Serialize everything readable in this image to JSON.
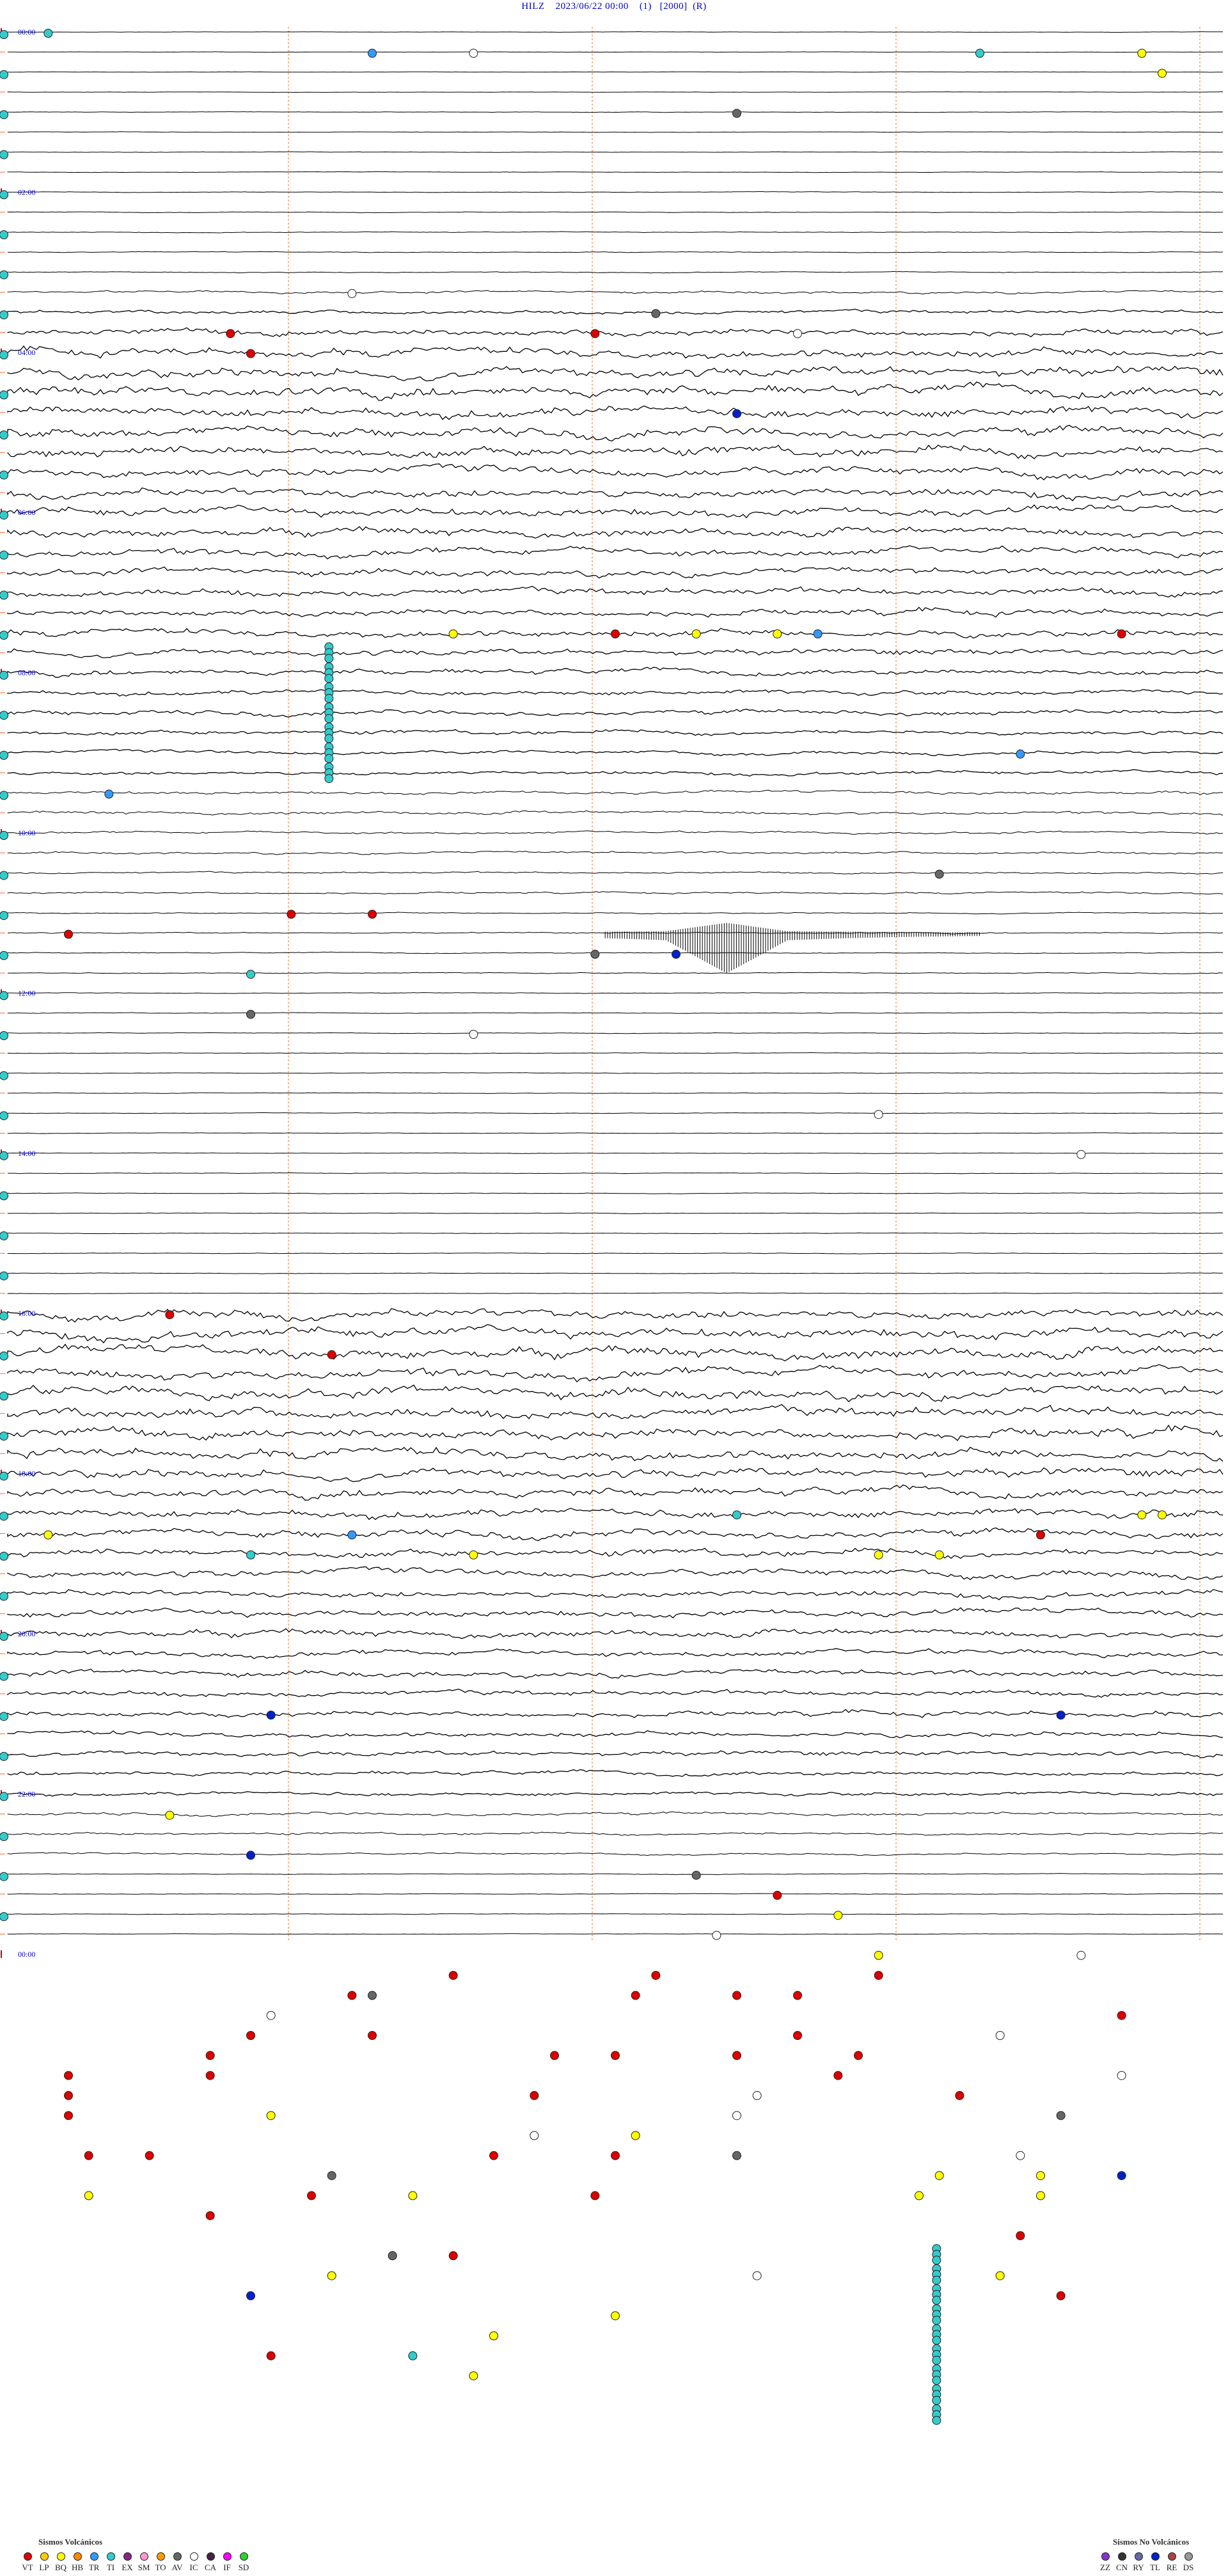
{
  "header": {
    "station": "HILZ",
    "datetime": "2023/06/22 00:00",
    "flag1": "(1)",
    "value": "[2000]",
    "flag2": "(R)"
  },
  "chart_data": {
    "type": "helicorder",
    "start_time": "2023/06/22 00:00",
    "rows_per_hour": 4,
    "hours": 24,
    "hour_labels": [
      "00:00",
      "02:00",
      "04:00",
      "06:00",
      "08:00",
      "10:00",
      "12:00",
      "14:00",
      "16:00",
      "18:00",
      "20:00",
      "22:00",
      "00:00"
    ],
    "minute_marks": [
      15,
      30,
      45,
      60
    ],
    "noise_levels": [
      0.03,
      0.03,
      0.03,
      0.03,
      0.04,
      0.04,
      0.04,
      0.04,
      0.05,
      0.06,
      0.06,
      0.06,
      0.08,
      0.2,
      0.3,
      0.55,
      0.7,
      0.8,
      0.85,
      0.85,
      0.8,
      0.8,
      0.75,
      0.75,
      0.7,
      0.65,
      0.65,
      0.6,
      0.6,
      0.55,
      0.55,
      0.5,
      0.45,
      0.4,
      0.4,
      0.35,
      0.3,
      0.3,
      0.25,
      0.25,
      0.2,
      0.2,
      0.15,
      0.15,
      0.1,
      0.1,
      0.08,
      0.08,
      0.06,
      0.06,
      0.05,
      0.05,
      0.05,
      0.05,
      0.05,
      0.05,
      0.05,
      0.05,
      0.05,
      0.05,
      0.05,
      0.05,
      0.05,
      0.05,
      0.8,
      0.85,
      0.85,
      0.85,
      0.9,
      0.85,
      0.85,
      0.8,
      0.75,
      0.7,
      0.7,
      0.65,
      0.6,
      0.6,
      0.55,
      0.55,
      0.55,
      0.5,
      0.5,
      0.45,
      0.45,
      0.4,
      0.4,
      0.35,
      0.3,
      0.25,
      0.2,
      0.15,
      0.06,
      0.05,
      0.05,
      0.05
    ],
    "events": [
      {
        "row": 0,
        "min": 2,
        "type": "TI"
      },
      {
        "row": 1,
        "min": 18,
        "type": "TR"
      },
      {
        "row": 1,
        "min": 23,
        "type": "IC"
      },
      {
        "row": 1,
        "min": 48,
        "type": "TI"
      },
      {
        "row": 1,
        "min": 56,
        "type": "BQ"
      },
      {
        "row": 2,
        "min": 57,
        "type": "BQ"
      },
      {
        "row": 4,
        "min": 36,
        "type": "AV"
      },
      {
        "row": 13,
        "min": 17,
        "type": "IC"
      },
      {
        "row": 14,
        "min": 32,
        "type": "AV"
      },
      {
        "row": 15,
        "min": 11,
        "type": "VT"
      },
      {
        "row": 15,
        "min": 29,
        "type": "VT"
      },
      {
        "row": 15,
        "min": 39,
        "type": "IC"
      },
      {
        "row": 16,
        "min": 12,
        "type": "VT"
      },
      {
        "row": 19,
        "min": 36,
        "type": "TL"
      },
      {
        "row": 30,
        "min": 22,
        "type": "BQ"
      },
      {
        "row": 30,
        "min": 30,
        "type": "VT"
      },
      {
        "row": 30,
        "min": 34,
        "type": "BQ"
      },
      {
        "row": 30,
        "min": 38,
        "type": "BQ"
      },
      {
        "row": 30,
        "min": 40,
        "type": "TR"
      },
      {
        "row": 30,
        "min": 55,
        "type": "VT"
      },
      {
        "row": 36,
        "min": 50,
        "type": "TR"
      },
      {
        "row": 38,
        "min": 5,
        "type": "TR"
      },
      {
        "row": 42,
        "min": 46,
        "type": "AV"
      },
      {
        "row": 44,
        "min": 14,
        "type": "VT"
      },
      {
        "row": 44,
        "min": 18,
        "type": "VT"
      },
      {
        "row": 45,
        "min": 3,
        "type": "VT"
      },
      {
        "row": 46,
        "min": 33,
        "type": "TL"
      },
      {
        "row": 46,
        "min": 29,
        "type": "AV"
      },
      {
        "row": 47,
        "min": 12,
        "type": "TI"
      },
      {
        "row": 49,
        "min": 12,
        "type": "AV"
      },
      {
        "row": 50,
        "min": 23,
        "type": "IC"
      },
      {
        "row": 54,
        "min": 43,
        "type": "IC"
      },
      {
        "row": 56,
        "min": 53,
        "type": "IC"
      },
      {
        "row": 64,
        "min": 8,
        "type": "VT"
      },
      {
        "row": 66,
        "min": 16,
        "type": "VT"
      },
      {
        "row": 74,
        "min": 36,
        "type": "TI"
      },
      {
        "row": 74,
        "min": 56,
        "type": "BQ"
      },
      {
        "row": 74,
        "min": 57,
        "type": "BQ"
      },
      {
        "row": 75,
        "min": 2,
        "type": "BQ"
      },
      {
        "row": 75,
        "min": 17,
        "type": "TR"
      },
      {
        "row": 75,
        "min": 51,
        "type": "VT"
      },
      {
        "row": 76,
        "min": 12,
        "type": "TI"
      },
      {
        "row": 76,
        "min": 23,
        "type": "BQ"
      },
      {
        "row": 76,
        "min": 43,
        "type": "BQ"
      },
      {
        "row": 76,
        "min": 46,
        "type": "BQ"
      },
      {
        "row": 84,
        "min": 13,
        "type": "TL"
      },
      {
        "row": 84,
        "min": 52,
        "type": "TL"
      },
      {
        "row": 89,
        "min": 8,
        "type": "BQ"
      },
      {
        "row": 91,
        "min": 12,
        "type": "TL"
      },
      {
        "row": 92,
        "min": 34,
        "type": "AV"
      },
      {
        "row": 93,
        "min": 38,
        "type": "VT"
      },
      {
        "row": 94,
        "min": 41,
        "type": "BQ"
      },
      {
        "row": 95,
        "min": 35,
        "type": "IC"
      },
      {
        "row": 96,
        "min": 43,
        "type": "BQ"
      },
      {
        "row": 96,
        "min": 53,
        "type": "IC"
      },
      {
        "row": 97,
        "min": 22,
        "type": "VT"
      },
      {
        "row": 97,
        "min": 32,
        "type": "VT"
      },
      {
        "row": 97,
        "min": 43,
        "type": "VT"
      },
      {
        "row": 98,
        "min": 17,
        "type": "VT"
      },
      {
        "row": 98,
        "min": 18,
        "type": "AV"
      },
      {
        "row": 98,
        "min": 31,
        "type": "VT"
      },
      {
        "row": 98,
        "min": 36,
        "type": "VT"
      },
      {
        "row": 98,
        "min": 39,
        "type": "VT"
      },
      {
        "row": 99,
        "min": 13,
        "type": "IC"
      },
      {
        "row": 99,
        "min": 55,
        "type": "VT"
      },
      {
        "row": 100,
        "min": 12,
        "type": "VT"
      },
      {
        "row": 100,
        "min": 18,
        "type": "VT"
      },
      {
        "row": 100,
        "min": 39,
        "type": "VT"
      },
      {
        "row": 100,
        "min": 49,
        "type": "IC"
      },
      {
        "row": 101,
        "min": 10,
        "type": "VT"
      },
      {
        "row": 101,
        "min": 27,
        "type": "VT"
      },
      {
        "row": 101,
        "min": 30,
        "type": "VT"
      },
      {
        "row": 101,
        "min": 36,
        "type": "VT"
      },
      {
        "row": 101,
        "min": 42,
        "type": "VT"
      },
      {
        "row": 102,
        "min": 3,
        "type": "VT"
      },
      {
        "row": 102,
        "min": 10,
        "type": "VT"
      },
      {
        "row": 102,
        "min": 41,
        "type": "VT"
      },
      {
        "row": 102,
        "min": 55,
        "type": "IC"
      },
      {
        "row": 103,
        "min": 3,
        "type": "VT"
      },
      {
        "row": 103,
        "min": 26,
        "type": "VT"
      },
      {
        "row": 103,
        "min": 37,
        "type": "IC"
      },
      {
        "row": 103,
        "min": 47,
        "type": "VT"
      },
      {
        "row": 104,
        "min": 3,
        "type": "VT"
      },
      {
        "row": 104,
        "min": 13,
        "type": "BQ"
      },
      {
        "row": 104,
        "min": 36,
        "type": "IC"
      },
      {
        "row": 104,
        "min": 52,
        "type": "AV"
      },
      {
        "row": 105,
        "min": 26,
        "type": "IC"
      },
      {
        "row": 105,
        "min": 31,
        "type": "BQ"
      },
      {
        "row": 106,
        "min": 4,
        "type": "VT"
      },
      {
        "row": 106,
        "min": 7,
        "type": "VT"
      },
      {
        "row": 106,
        "min": 24,
        "type": "VT"
      },
      {
        "row": 106,
        "min": 30,
        "type": "VT"
      },
      {
        "row": 106,
        "min": 36,
        "type": "AV"
      },
      {
        "row": 106,
        "min": 50,
        "type": "IC"
      },
      {
        "row": 107,
        "min": 16,
        "type": "AV"
      },
      {
        "row": 107,
        "min": 46,
        "type": "BQ"
      },
      {
        "row": 107,
        "min": 51,
        "type": "BQ"
      },
      {
        "row": 107,
        "min": 55,
        "type": "TL"
      },
      {
        "row": 108,
        "min": 4,
        "type": "BQ"
      },
      {
        "row": 108,
        "min": 20,
        "type": "BQ"
      },
      {
        "row": 108,
        "min": 15,
        "type": "VT"
      },
      {
        "row": 108,
        "min": 29,
        "type": "VT"
      },
      {
        "row": 108,
        "min": 45,
        "type": "BQ"
      },
      {
        "row": 108,
        "min": 51,
        "type": "BQ"
      },
      {
        "row": 109,
        "min": 10,
        "type": "VT"
      },
      {
        "row": 110,
        "min": 50,
        "type": "VT"
      },
      {
        "row": 111,
        "min": 19,
        "type": "VT"
      },
      {
        "row": 111,
        "min": 22,
        "type": "VT"
      },
      {
        "row": 111,
        "min": 19,
        "type": "AV"
      },
      {
        "row": 112,
        "min": 16,
        "type": "BQ"
      },
      {
        "row": 112,
        "min": 49,
        "type": "BQ"
      },
      {
        "row": 112,
        "min": 37,
        "type": "IC"
      },
      {
        "row": 113,
        "min": 12,
        "type": "TL"
      },
      {
        "row": 113,
        "min": 52,
        "type": "VT"
      },
      {
        "row": 114,
        "min": 30,
        "type": "BQ"
      },
      {
        "row": 115,
        "min": 24,
        "type": "BQ"
      },
      {
        "row": 116,
        "min": 20,
        "type": "TI"
      },
      {
        "row": 116,
        "min": 13,
        "type": "VT"
      },
      {
        "row": 117,
        "min": 23,
        "type": "BQ"
      }
    ],
    "swarms": [
      {
        "row_start": 31,
        "row_end": 37,
        "min": 17,
        "type": "TI"
      },
      {
        "row_start": 111,
        "row_end": 119,
        "min": 47,
        "type": "TI"
      }
    ],
    "large_event": {
      "row": 45,
      "min_start": 29.5,
      "min_end": 48,
      "peak_min": 35.5
    }
  },
  "legend": {
    "volcanic_title": "Sismos Volcánicos",
    "volcanic": [
      {
        "code": "VT",
        "color": "#dd0000"
      },
      {
        "code": "LP",
        "color": "#ffcc00"
      },
      {
        "code": "BQ",
        "color": "#ffff00"
      },
      {
        "code": "HB",
        "color": "#ff8800"
      },
      {
        "code": "TR",
        "color": "#3399ff"
      },
      {
        "code": "TI",
        "color": "#33cccc"
      },
      {
        "code": "EX",
        "color": "#882288"
      },
      {
        "code": "SM",
        "color": "#ff99cc"
      },
      {
        "code": "TO",
        "color": "#ff9900"
      },
      {
        "code": "AV",
        "color": "#666666"
      },
      {
        "code": "IC",
        "color": "#ffffff"
      },
      {
        "code": "CA",
        "color": "#442244"
      },
      {
        "code": "IF",
        "color": "#ff00ff"
      },
      {
        "code": "SD",
        "color": "#33cc33"
      }
    ],
    "nonvolcanic_title": "Sismos No Volcánicos",
    "nonvolcanic": [
      {
        "code": "ZZ",
        "color": "#8833cc"
      },
      {
        "code": "CN",
        "color": "#333333"
      },
      {
        "code": "RY",
        "color": "#6666aa"
      },
      {
        "code": "TL",
        "color": "#0022cc"
      },
      {
        "code": "RE",
        "color": "#aa4444"
      },
      {
        "code": "DS",
        "color": "#999999"
      }
    ]
  }
}
